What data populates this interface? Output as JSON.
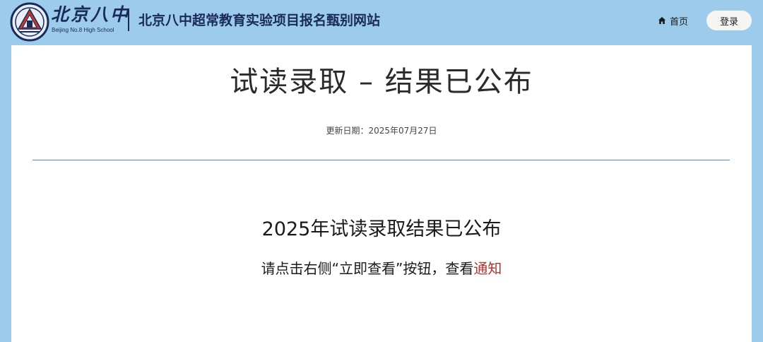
{
  "header": {
    "logo_cn": "北京八中",
    "logo_en": "Beijing No.8 High School",
    "site_title": "北京八中超常教育实验项目报名甄别网站",
    "nav_home": "首页",
    "login": "登录"
  },
  "main": {
    "title": "试读录取 – 结果已公布",
    "update_date": "更新日期：2025年07月27日",
    "heading": "2025年试读录取结果已公布",
    "instruction": "请点击右侧“立即查看”按钮，查看",
    "link_text": "通知"
  },
  "colors": {
    "header_bg": "#9ccbeb",
    "brand_navy": "#1a2a5a",
    "link_red": "#b8312f",
    "divider": "#4a8fb5"
  },
  "icons": {
    "logo": "school-emblem-icon",
    "home": "home-icon"
  }
}
